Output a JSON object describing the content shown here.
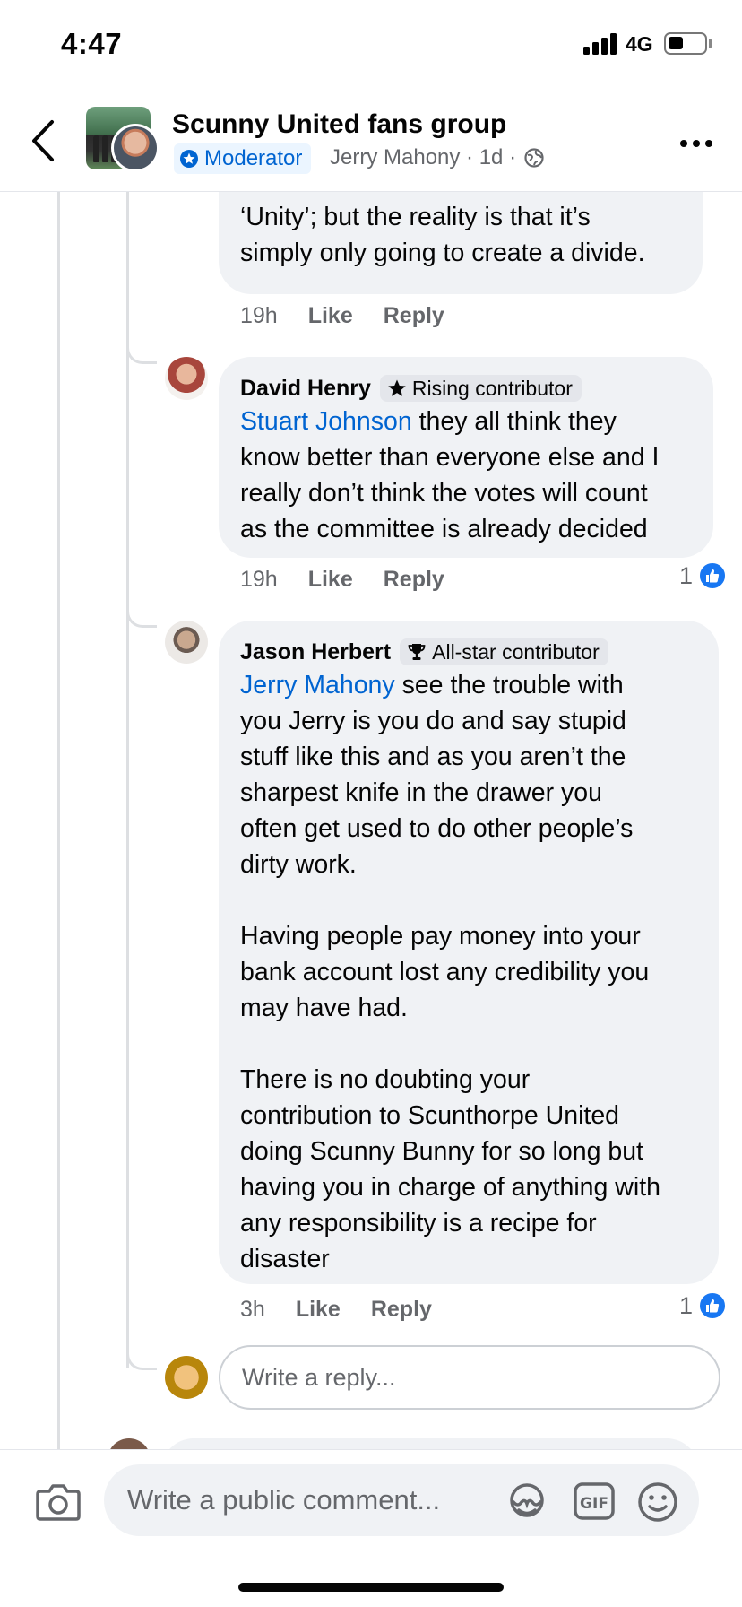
{
  "status_bar": {
    "time": "4:47",
    "network": "4G",
    "battery_level": 0.4
  },
  "header": {
    "title": "Scunny United fans group",
    "moderator_label": "Moderator",
    "meta": "Jerry Mahony · 1d ·",
    "icons": {
      "back": "back-chevron-icon",
      "privacy": "globe-icon",
      "more": "more-options-icon"
    }
  },
  "comments": [
    {
      "text_tail": "‘Unity’; but the reality is that it’s\nsimply only going to create a divide.",
      "time": "19h",
      "like_label": "Like",
      "reply_label": "Reply"
    },
    {
      "author": "David Henry",
      "badge": "Rising contributor",
      "badge_icon": "star-icon",
      "mention": "Stuart Johnson",
      "text": " they all think they\nknow better than everyone else and I\nreally don’t think the votes will count\nas the committee is already decided",
      "time": "19h",
      "like_label": "Like",
      "reply_label": "Reply",
      "reactions": "1"
    },
    {
      "author": "Jason Herbert",
      "badge": "All-star contributor",
      "badge_icon": "trophy-icon",
      "mention": "Jerry Mahony",
      "text": " see the trouble with\nyou Jerry is you do and say stupid\nstuff like this and as you aren’t the\nsharpest knife in the drawer you\noften get used to do other people’s\ndirty work.\n\nHaving people pay money into your\nbank account lost any credibility you\nmay have had.\n\nThere is no doubting your\ncontribution to Scunthorpe United\ndoing Scunny Bunny for so long but\nhaving you in charge of anything with\nany responsibility is a recipe for\ndisaster",
      "time": "3h",
      "like_label": "Like",
      "reply_label": "Reply",
      "reactions": "1"
    }
  ],
  "reply_input": {
    "placeholder": "Write a reply..."
  },
  "composer": {
    "placeholder": "Write a public comment...",
    "icons": [
      "camera-icon",
      "avatar-sticker-icon",
      "gif-icon",
      "emoji-icon"
    ]
  },
  "colors": {
    "accent": "#0064d1",
    "like_blue": "#1877f2",
    "bubble_bg": "#f0f2f5",
    "secondary_text": "#65676b"
  }
}
